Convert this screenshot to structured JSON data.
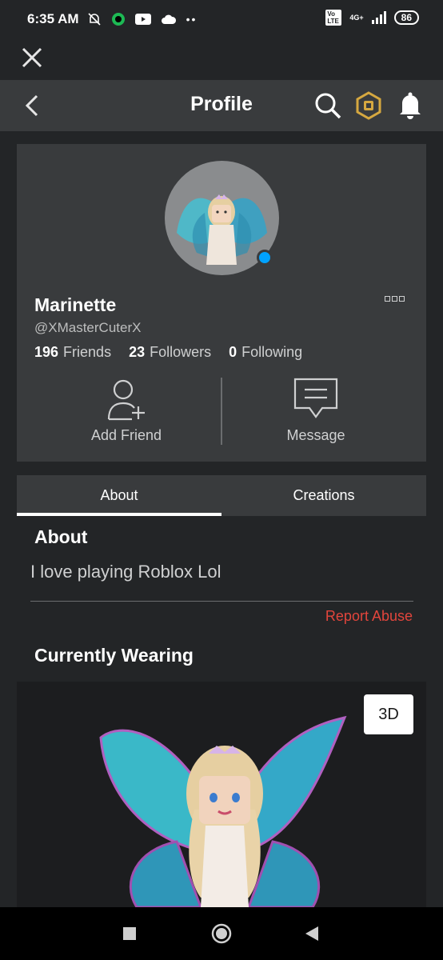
{
  "status": {
    "time": "6:35 AM",
    "network": "4G+",
    "volte": "Vo LTE",
    "battery": "86"
  },
  "header": {
    "title": "Profile"
  },
  "profile": {
    "display_name": "Marinette",
    "username": "@XMasterCuterX",
    "friends_count": "196",
    "friends_label": "Friends",
    "followers_count": "23",
    "followers_label": "Followers",
    "following_count": "0",
    "following_label": "Following"
  },
  "actions": {
    "add_friend": "Add Friend",
    "message": "Message"
  },
  "tabs": [
    {
      "label": "About"
    },
    {
      "label": "Creations"
    }
  ],
  "about": {
    "heading": "About",
    "text": "I love playing Roblox Lol",
    "report": "Report Abuse"
  },
  "wearing": {
    "heading": "Currently Wearing",
    "btn_3d": "3D"
  },
  "colors": {
    "accent_online": "#00a2ff",
    "report": "#e2453c",
    "robux": "#d6a840"
  }
}
